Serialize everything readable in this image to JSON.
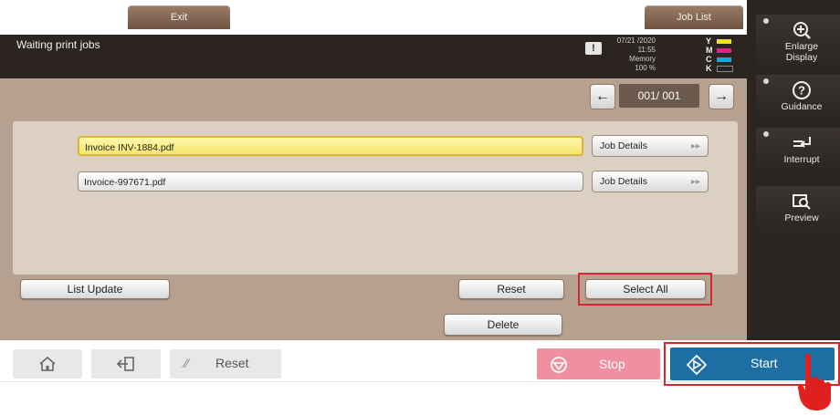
{
  "top_tabs": {
    "exit": "Exit",
    "job_list": "Job List"
  },
  "header": {
    "title": "Waiting print jobs",
    "status_box_glyph": "!",
    "date": "07/21 /2020",
    "time": "11:55",
    "memory_label": "Memory",
    "memory_value": "100 %",
    "toner": [
      {
        "letter": "Y",
        "color": "#f2e600"
      },
      {
        "letter": "M",
        "color": "#e0218a"
      },
      {
        "letter": "C",
        "color": "#18a8d8"
      },
      {
        "letter": "K",
        "color": "#222222"
      }
    ]
  },
  "pager": {
    "prev_glyph": "←",
    "next_glyph": "→",
    "count": "001/ 001"
  },
  "files": [
    {
      "name": "Invoice INV-1884.pdf",
      "selected": true,
      "details_label": "Job Details",
      "arrow": "▸▸"
    },
    {
      "name": "Invoice-997671.pdf",
      "selected": false,
      "details_label": "Job Details",
      "arrow": "▸▸"
    }
  ],
  "actions": {
    "list_update": "List Update",
    "reset": "Reset",
    "select_all": "Select All",
    "delete": "Delete"
  },
  "sidebar": {
    "items": [
      {
        "label_line1": "Enlarge",
        "label_line2": "Display",
        "icon": "zoom-in-icon"
      },
      {
        "label_line1": "Guidance",
        "label_line2": "",
        "icon": "help-icon"
      },
      {
        "label_line1": "Interrupt",
        "label_line2": "",
        "icon": "interrupt-icon"
      },
      {
        "label_line1": "Preview",
        "label_line2": "",
        "icon": "preview-icon"
      }
    ]
  },
  "bottom": {
    "reset_label": "Reset",
    "stop_label": "Stop",
    "start_label": "Start",
    "stop_color": "#f08fa0",
    "start_color": "#1d6fa3",
    "highlight_color": "#d6262e"
  }
}
